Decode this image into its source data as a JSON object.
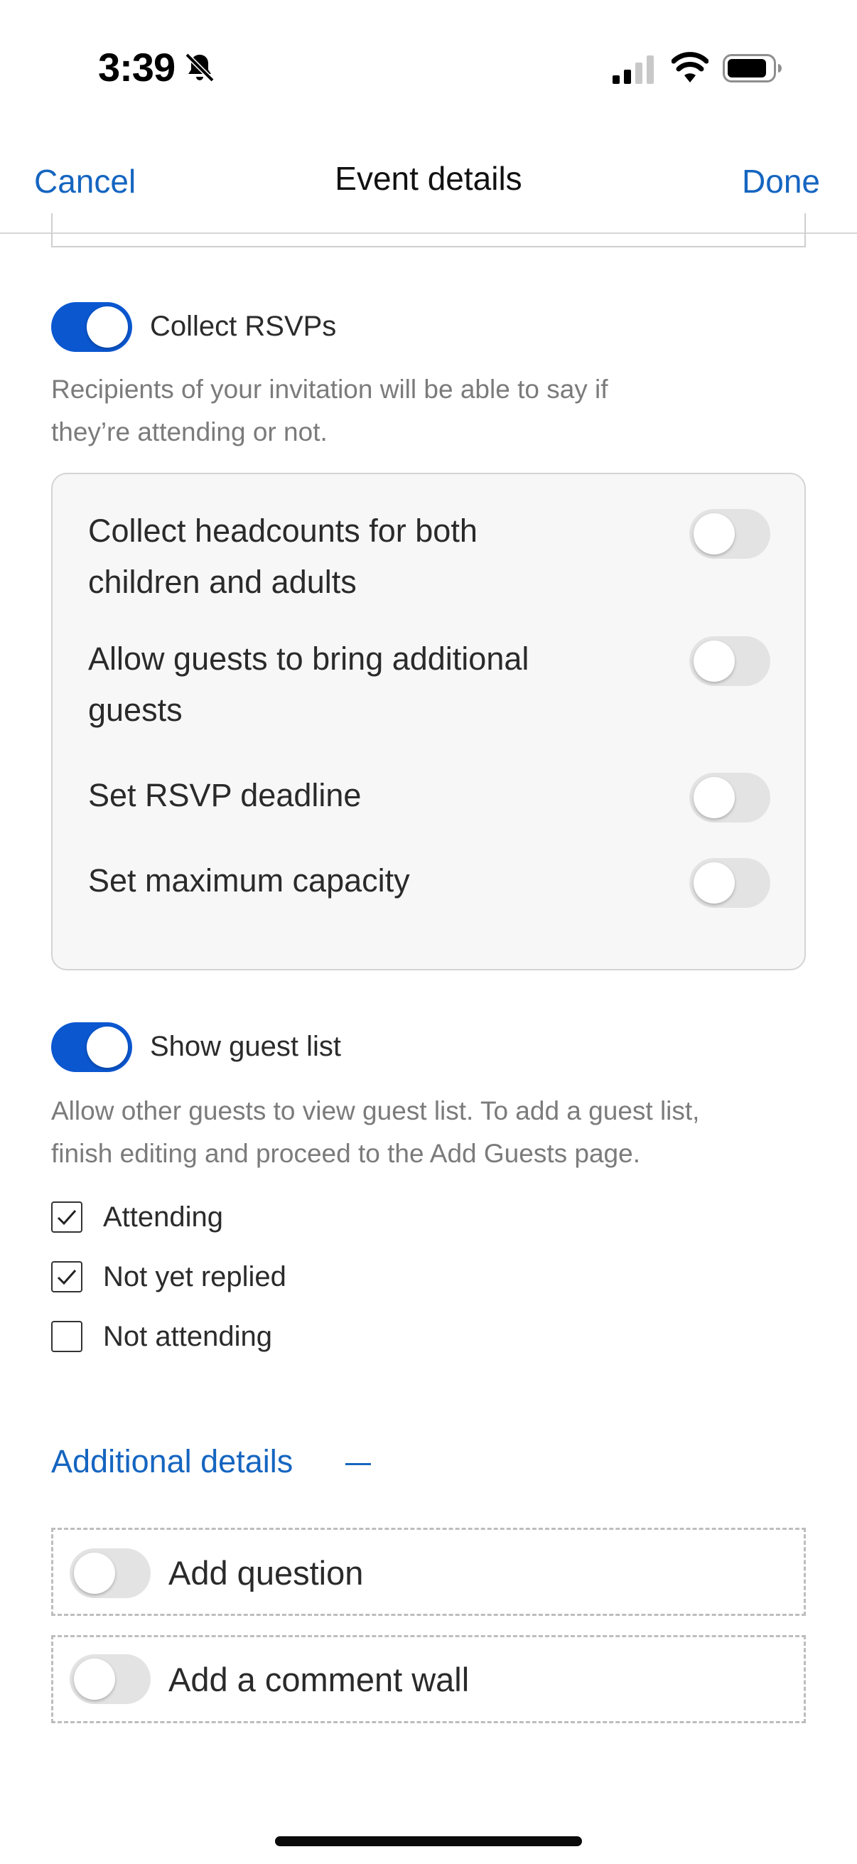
{
  "status_bar": {
    "time": "3:39"
  },
  "nav": {
    "cancel_label": "Cancel",
    "title": "Event details",
    "done_label": "Done"
  },
  "rsvp": {
    "toggle_label": "Collect RSVPs",
    "enabled": true,
    "description_line1": "Recipients of your invitation will be able to say if",
    "description_line2": "they’re attending or not.",
    "options": [
      {
        "line1": "Collect headcounts for both",
        "line2": "children and adults",
        "enabled": false
      },
      {
        "line1": "Allow guests to bring additional",
        "line2": "guests",
        "enabled": false
      },
      {
        "line1": "Set RSVP deadline",
        "enabled": false
      },
      {
        "line1": "Set maximum capacity",
        "enabled": false
      }
    ]
  },
  "guest_list": {
    "toggle_label": "Show guest list",
    "enabled": true,
    "description_line1": "Allow other guests to view guest list. To add a guest list,",
    "description_line2": "finish editing and proceed to the Add Guests page.",
    "filters": [
      {
        "label": "Attending",
        "checked": true
      },
      {
        "label": "Not yet replied",
        "checked": true
      },
      {
        "label": "Not attending",
        "checked": false
      }
    ]
  },
  "additional_details": {
    "heading": "Additional details",
    "items": [
      {
        "label": "Add question",
        "enabled": false
      },
      {
        "label": "Add a comment wall",
        "enabled": false
      }
    ]
  },
  "colors": {
    "accent": "#1565c0",
    "toggle_on": "#0b57d0",
    "toggle_off": "#e3e3e3"
  },
  "icons": [
    "bell-slash-icon",
    "cellular-signal-icon",
    "wifi-icon",
    "battery-icon",
    "checkmark-icon",
    "minus-icon"
  ]
}
